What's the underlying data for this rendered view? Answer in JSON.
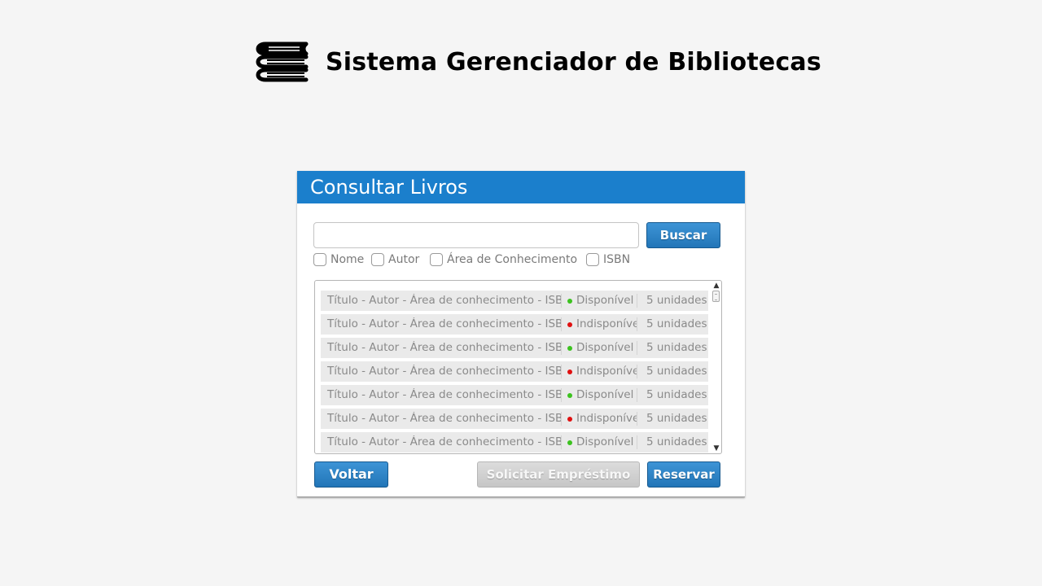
{
  "app": {
    "title": "Sistema Gerenciador de Bibliotecas"
  },
  "panel": {
    "title": "Consultar Livros"
  },
  "search": {
    "value": "",
    "placeholder": "",
    "button_label": "Buscar"
  },
  "filters": [
    {
      "label": "Nome",
      "checked": false
    },
    {
      "label": "Autor",
      "checked": false
    },
    {
      "label": "Área de Conhecimento",
      "checked": false
    },
    {
      "label": "ISBN",
      "checked": false
    }
  ],
  "results": [
    {
      "title": "Título - Autor - Área de conhecimento - ISBN",
      "status": "Disponível",
      "status_color": "#3cc21f",
      "quantity": "5 unidades"
    },
    {
      "title": "Título - Autor - Área de conhecimento - ISBN",
      "status": "Indisponível",
      "status_color": "#e01010",
      "quantity": "5 unidades"
    },
    {
      "title": "Título - Autor - Área de conhecimento - ISBN",
      "status": "Disponível",
      "status_color": "#3cc21f",
      "quantity": "5 unidades"
    },
    {
      "title": "Título - Autor - Área de conhecimento - ISBN",
      "status": "Indisponível",
      "status_color": "#e01010",
      "quantity": "5 unidades"
    },
    {
      "title": "Título - Autor - Área de conhecimento - ISBN",
      "status": "Disponível",
      "status_color": "#3cc21f",
      "quantity": "5 unidades"
    },
    {
      "title": "Título - Autor - Área de conhecimento - ISBN",
      "status": "Indisponível",
      "status_color": "#e01010",
      "quantity": "5 unidades"
    },
    {
      "title": "Título - Autor - Área de conhecimento - ISBN",
      "status": "Disponível",
      "status_color": "#3cc21f",
      "quantity": "5 unidades"
    }
  ],
  "actions": {
    "back_label": "Voltar",
    "loan_label": "Solicitar Empréstimo",
    "reserve_label": "Reservar"
  },
  "colors": {
    "header_blue": "#1b7fcc",
    "button_blue": "#2a82c6",
    "available": "#3cc21f",
    "unavailable": "#e01010"
  }
}
